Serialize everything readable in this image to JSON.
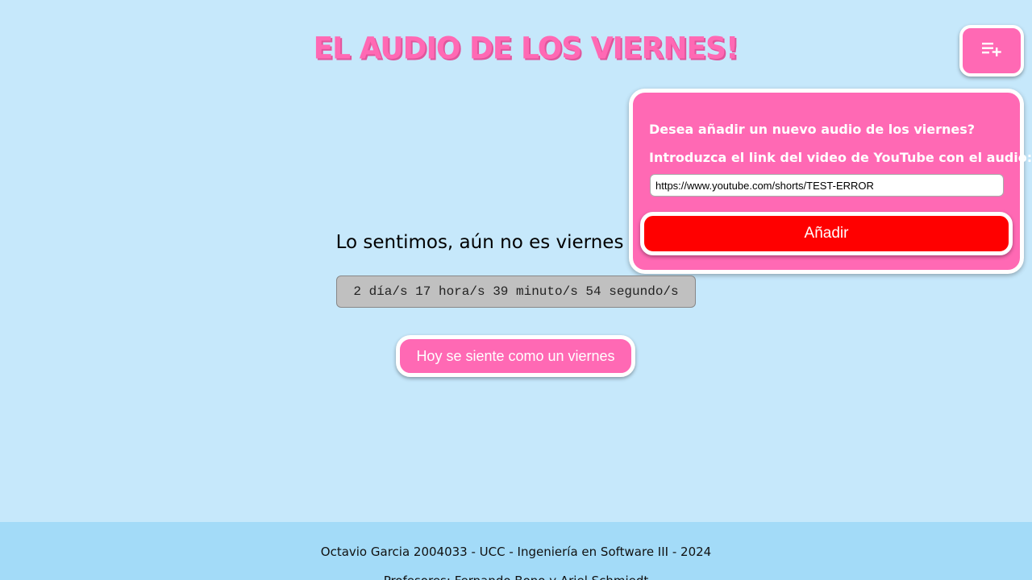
{
  "header": {
    "title": "EL AUDIO DE LOS VIERNES!",
    "menu_icon": "playlist-add-icon"
  },
  "popup": {
    "question": "Desea añadir un nuevo audio de los viernes?",
    "instruction": "Introduzca el link del video de YouTube con el audio:",
    "url_value": "https://www.youtube.com/shorts/TEST-ERROR",
    "add_label": "Añadir"
  },
  "main": {
    "message": "Lo sentimos, aún no es viernes",
    "countdown": "2 día/s 17 hora/s 39 minuto/s 54 segundo/s",
    "friday_button": "Hoy se siente como un viernes"
  },
  "footer": {
    "credit": "Octavio Garcia 2004033 - UCC - Ingeniería en Software III - 2024",
    "professor": "Profesores: Fernando Bono y Ariel Schmiedt"
  },
  "colors": {
    "background": "#c6e8fb",
    "accent_pink": "#ff69b4",
    "add_button": "#ff0000",
    "footer_bg": "#a3dbf8"
  }
}
